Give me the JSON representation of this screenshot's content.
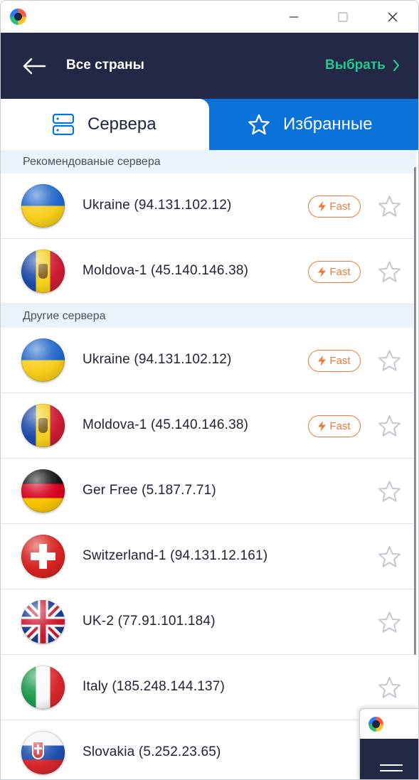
{
  "window": {
    "controls": {
      "minimize": "minimize-icon",
      "maximize": "maximize-icon",
      "close": "close-icon"
    }
  },
  "header": {
    "title": "Все страны",
    "select_label": "Выбрать"
  },
  "tabs": {
    "servers_label": "Сервера",
    "favorites_label": "Избранные"
  },
  "sections": {
    "recommended": "Рекомендованые сервера",
    "other": "Другие сервера"
  },
  "badge_label": "Fast",
  "recommended_servers": [
    {
      "name": "Ukraine (94.131.102.12)",
      "flag": "ukraine-flag",
      "fast": true
    },
    {
      "name": "Moldova-1 (45.140.146.38)",
      "flag": "moldova-flag",
      "fast": true
    }
  ],
  "other_servers": [
    {
      "name": "Ukraine (94.131.102.12)",
      "flag": "ukraine-flag",
      "fast": true
    },
    {
      "name": "Moldova-1 (45.140.146.38)",
      "flag": "moldova-flag",
      "fast": true
    },
    {
      "name": "Ger Free (5.187.7.71)",
      "flag": "germany-flag",
      "fast": false
    },
    {
      "name": "Switzerland-1 (94.131.12.161)",
      "flag": "switzerland-flag",
      "fast": false
    },
    {
      "name": "UK-2 (77.91.101.184)",
      "flag": "uk-flag",
      "fast": false
    },
    {
      "name": "Italy (185.248.144.137)",
      "flag": "italy-flag",
      "fast": false
    },
    {
      "name": "Slovakia (5.252.23.65)",
      "flag": "slovakia-flag",
      "fast": false
    }
  ],
  "colors": {
    "header_bg": "#222845",
    "accent_blue": "#0a72d8",
    "accent_green": "#23c98d",
    "fast_orange": "#f07a3c",
    "section_bg": "#eaf2fb"
  }
}
